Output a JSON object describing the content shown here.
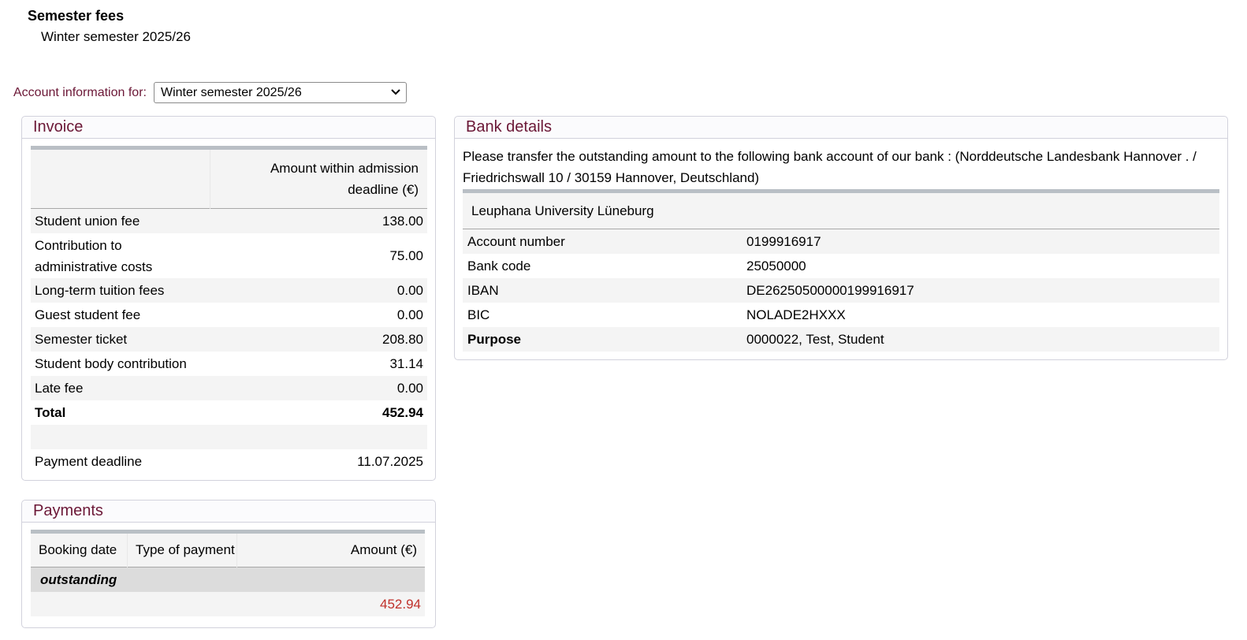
{
  "header": {
    "title": "Semester fees",
    "subtitle": "Winter semester 2025/26"
  },
  "account": {
    "label": "Account information for:",
    "selected": "Winter semester 2025/26"
  },
  "invoice": {
    "title": "Invoice",
    "column_header_line1": "Amount within admission",
    "column_header_line2": "deadline (€)",
    "rows": [
      {
        "label": "Student union fee",
        "value": "138.00"
      },
      {
        "label_line1": "Contribution to",
        "label_line2": "administrative costs",
        "value": "75.00"
      },
      {
        "label": "Long-term tuition fees",
        "value": "0.00"
      },
      {
        "label": "Guest student fee",
        "value": "0.00"
      },
      {
        "label": "Semester ticket",
        "value": "208.80"
      },
      {
        "label": "Student body contribution",
        "value": "31.14"
      },
      {
        "label": "Late fee",
        "value": "0.00"
      }
    ],
    "total_label": "Total",
    "total_value": "452.94",
    "deadline_label": "Payment deadline",
    "deadline_value": "11.07.2025"
  },
  "payments": {
    "title": "Payments",
    "columns": [
      "Booking date",
      "Type of payment",
      "Amount (€)"
    ],
    "outstanding_label": "outstanding",
    "outstanding_amount": "452.94",
    "outstanding_color": "#c0312b"
  },
  "bank": {
    "title": "Bank details",
    "intro_line1": "Please transfer the outstanding amount to the following bank account of our bank : (Norddeutsche Landesbank Hannover . /",
    "intro_line2": "Friedrichswall 10 / 30159 Hannover, Deutschland)",
    "recipient": "Leuphana University Lüneburg",
    "rows": [
      {
        "label": "Account number",
        "value": "0199916917"
      },
      {
        "label": "Bank code",
        "value": "25050000"
      },
      {
        "label": "IBAN",
        "value": "DE26250500000199916917"
      },
      {
        "label": "BIC",
        "value": "NOLADE2HXXX"
      },
      {
        "label": "Purpose",
        "value": "0000022, Test, Student"
      }
    ]
  },
  "colors": {
    "heading": "#6b1736",
    "table_rule": "#b9bfc5",
    "alt_row": "#f4f4f4"
  }
}
